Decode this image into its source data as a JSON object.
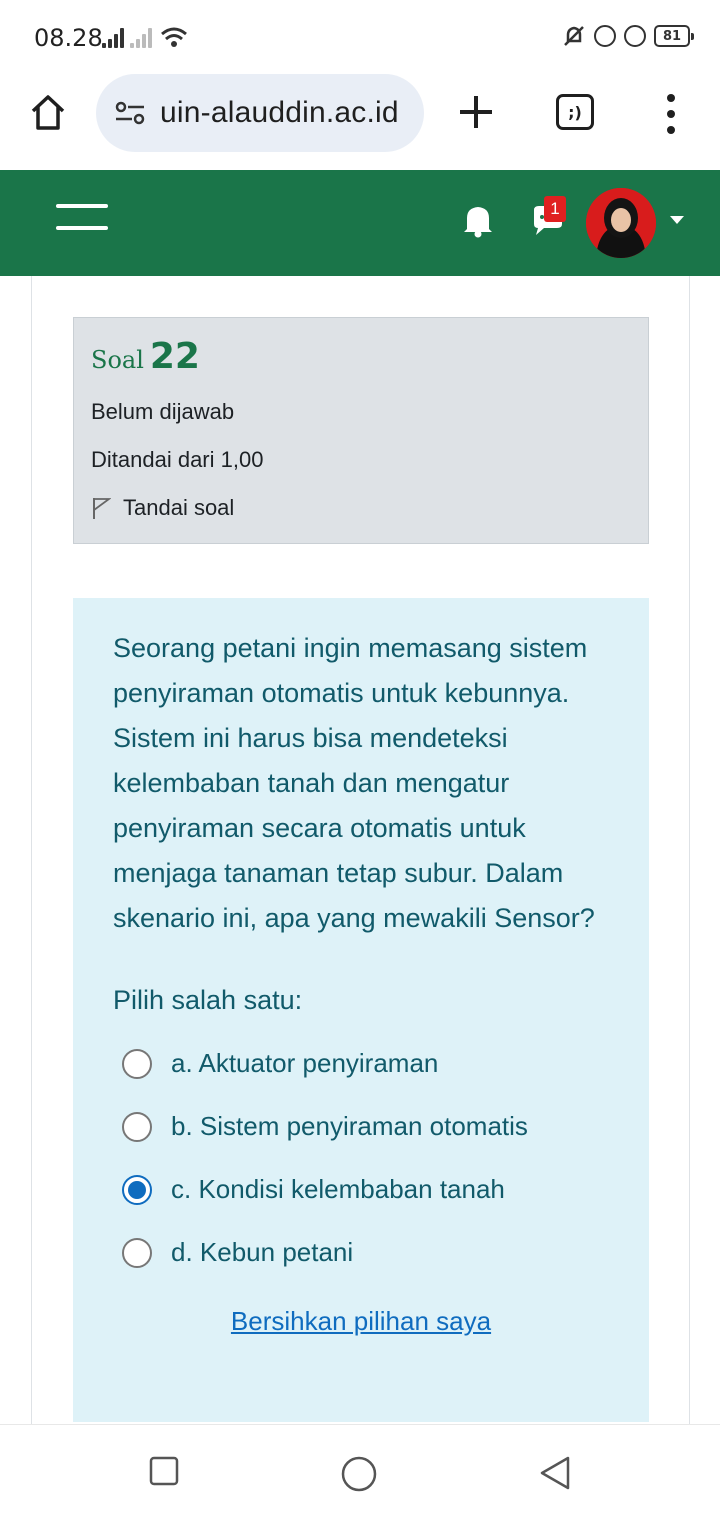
{
  "status_bar": {
    "time": "08.28",
    "battery": "81"
  },
  "browser": {
    "url": "uin-alauddin.ac.id",
    "tabs_glyph": ";)"
  },
  "navbar": {
    "chat_badge": "1",
    "accent_color": "#1a7549"
  },
  "question_info": {
    "label": "Soal",
    "number": "22",
    "status": "Belum dijawab",
    "mark": "Ditandai dari 1,00",
    "flag_label": "Tandai soal"
  },
  "question": {
    "text": "Seorang petani ingin memasang sistem penyiraman otomatis untuk kebunnya. Sistem ini harus bisa mendeteksi kelembaban tanah dan mengatur penyiraman secara otomatis untuk menjaga tanaman tetap subur. Dalam skenario ini, apa yang mewakili Sensor?",
    "prompt": "Pilih salah satu:",
    "answers": [
      {
        "label": "a. Aktuator penyiraman",
        "selected": false
      },
      {
        "label": "b. Sistem penyiraman otomatis",
        "selected": false
      },
      {
        "label": "c. Kondisi kelembaban tanah",
        "selected": true
      },
      {
        "label": "d. Kebun petani",
        "selected": false
      }
    ],
    "clear_label": "Bersihkan pilihan saya"
  },
  "icons": [
    "home-icon",
    "tune-icon",
    "plus-icon",
    "tabs-icon",
    "more-icon",
    "menu-icon",
    "bell-icon",
    "chat-icon",
    "flag-icon",
    "recents-icon",
    "home-circle-icon",
    "back-icon"
  ]
}
